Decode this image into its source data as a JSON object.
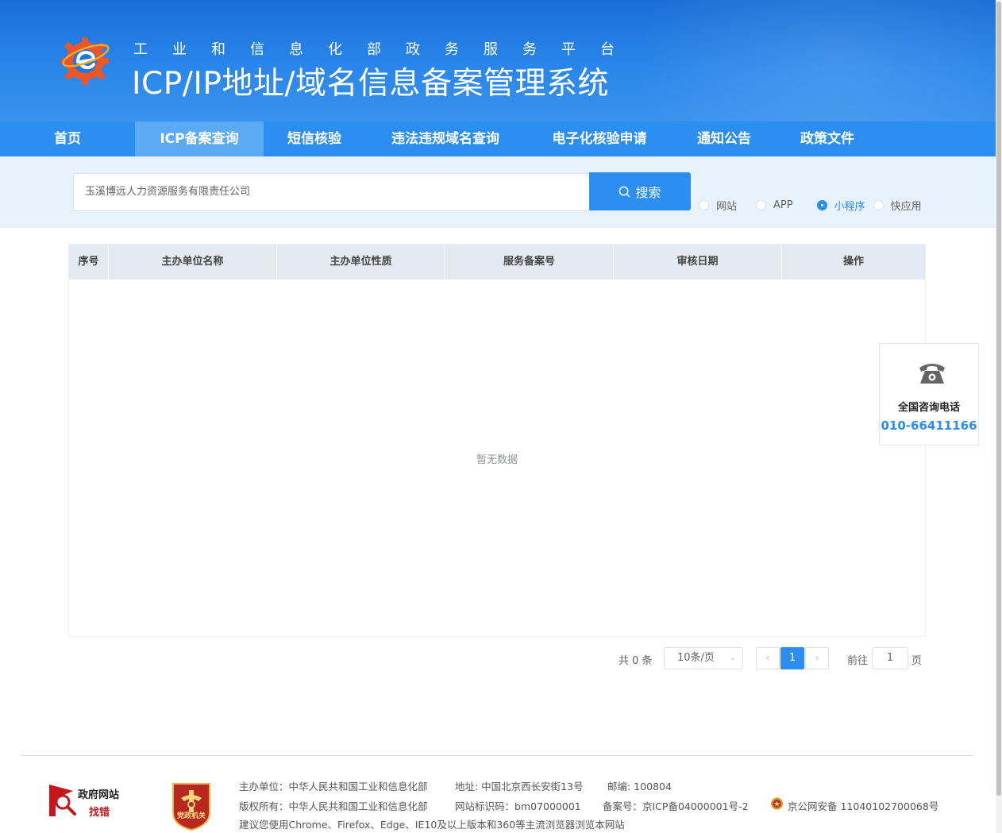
{
  "header": {
    "subtitle": "工业和信息化部政务服务平台",
    "title": "ICP/IP地址/域名信息备案管理系统"
  },
  "nav": {
    "items": [
      {
        "label": "首页",
        "active": false
      },
      {
        "label": "ICP备案查询",
        "active": true
      },
      {
        "label": "短信核验",
        "active": false
      },
      {
        "label": "违法违规域名查询",
        "active": false
      },
      {
        "label": "电子化核验申请",
        "active": false
      },
      {
        "label": "通知公告",
        "active": false
      },
      {
        "label": "政策文件",
        "active": false
      }
    ]
  },
  "search": {
    "value": "玉溪博远人力资源服务有限责任公司",
    "button_label": "搜索",
    "types": [
      {
        "label": "网站",
        "checked": false
      },
      {
        "label": "APP",
        "checked": false
      },
      {
        "label": "小程序",
        "checked": true
      },
      {
        "label": "快应用",
        "checked": false
      }
    ]
  },
  "table": {
    "columns": [
      "序号",
      "主办单位名称",
      "主办单位性质",
      "服务备案号",
      "审核日期",
      "操作"
    ],
    "rows": [],
    "empty_text": "暂无数据"
  },
  "pagination": {
    "total": "共 0 条",
    "page_size": "10条/页",
    "current_page": "1",
    "goto_label": "前往",
    "goto_value": "1",
    "page_unit": "页"
  },
  "contact": {
    "label": "全国咨询电话",
    "phone": "010-66411166"
  },
  "footer": {
    "gov_badge_line1": "政府网站",
    "gov_badge_line2": "找错",
    "party_badge": "党政机关",
    "sponsor": "主办单位：中华人民共和国工业和信息化部",
    "address": "地址: 中国北京西长安街13号",
    "postcode": "邮编: 100804",
    "copyright": "版权所有：中华人民共和国工业和信息化部",
    "site_id": "网站标识码：bm07000001",
    "icp": "备案号：京ICP备04000001号-2",
    "police": "京公网安备 11040102700068号",
    "browser_tip": "建议您使用Chrome、Firefox、Edge、IE10及以上版本和360等主流浏览器浏览本网站"
  },
  "colors": {
    "primary": "#2b8ef0",
    "nav_active": "#5aaaf5",
    "header_dark": "#1a6fd6",
    "search_bg": "#e8f2fd"
  }
}
